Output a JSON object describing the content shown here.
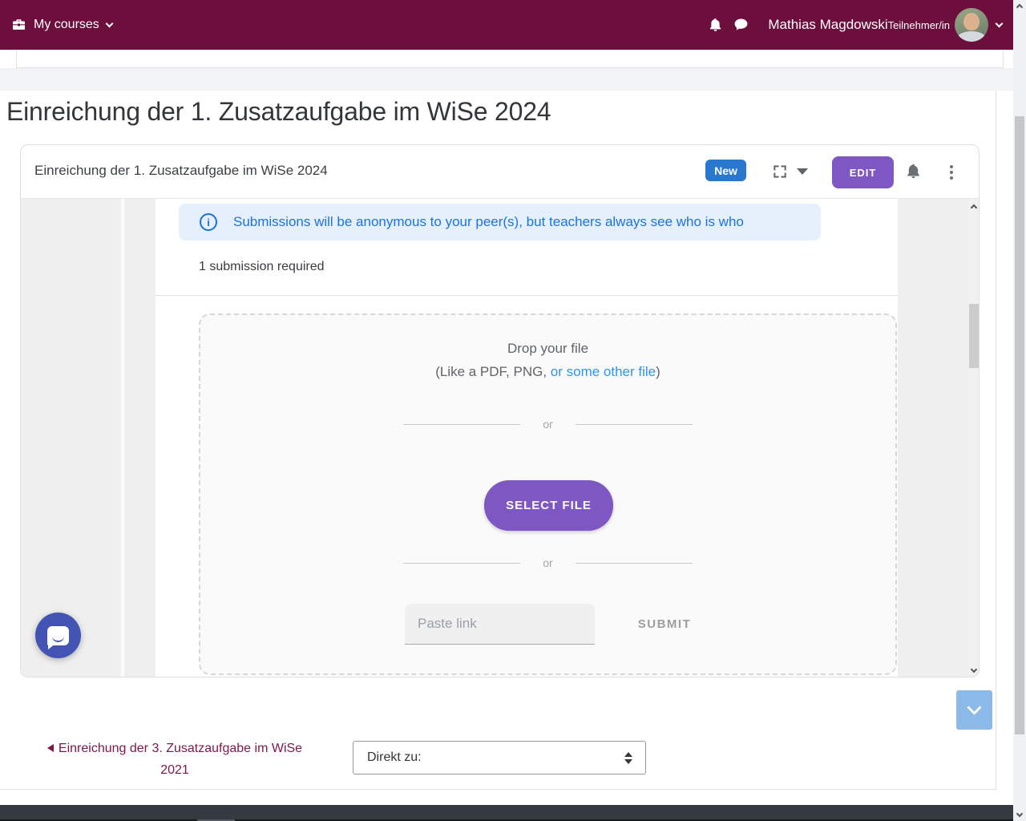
{
  "navbar": {
    "my_courses_label": "My courses",
    "user_name": "Mathias Magdowski",
    "user_role": "Teilnehmer/in"
  },
  "page": {
    "title": "Einreichung der 1. Zusatzaufgabe im WiSe 2024"
  },
  "card": {
    "title": "Einreichung der 1. Zusatzaufgabe im WiSe 2024",
    "new_badge": "New",
    "edit_label": "EDIT"
  },
  "submission": {
    "info_banner": "Submissions will be anonymous to your peer(s), but teachers always see who is who",
    "requirement": "1 submission required",
    "dropzone_title": "Drop your file",
    "hint_prefix": "(Like a PDF, PNG, ",
    "hint_link": "or some other file",
    "hint_suffix": ")",
    "or_divider": "or",
    "select_file_label": "SELECT FILE",
    "paste_link_placeholder": "Paste link",
    "submit_label": "SUBMIT"
  },
  "footer_nav": {
    "prev_link_label": "Einreichung der 3. Zusatzaufgabe im WiSe 2021",
    "jump_to_label": "Direkt zu:"
  },
  "colors": {
    "navbar_maroon": "#6d0f3d",
    "badge_blue": "#2878d0",
    "accent_purple": "#7e57c2",
    "info_blue": "#1a73e8",
    "hint_link_blue": "#2e95f0",
    "chat_fab_indigo": "#4354b5",
    "scroll_button_blue": "#8cbae8",
    "link_maroon": "#80194b",
    "footer_dark": "#343a40"
  }
}
